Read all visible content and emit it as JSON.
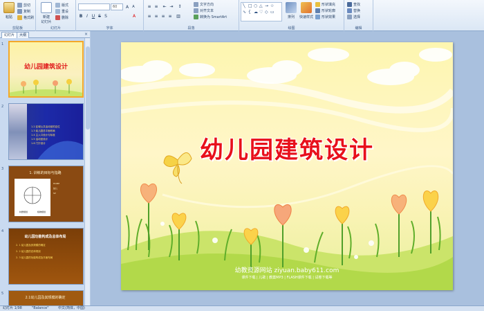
{
  "ribbon": {
    "clipboard": {
      "paste": "粘贴",
      "cut": "剪切",
      "copy": "复制",
      "format_painter": "格式刷",
      "label": "剪贴板"
    },
    "slides": {
      "new_slide": "新建\n幻灯片",
      "layout": "版式",
      "reset": "重设",
      "delete": "删除",
      "label": "幻灯片"
    },
    "font": {
      "size": "60",
      "label": "字体"
    },
    "paragraph": {
      "text_direction": "文字方向",
      "align_text": "对齐文本",
      "smartart": "转换为 SmartArt",
      "label": "段落"
    },
    "drawing": {
      "arrange": "排列",
      "quick_styles": "快速样式",
      "shape_fill": "形状填充",
      "shape_outline": "形状轮廓",
      "shape_effects": "形状效果",
      "label": "绘图"
    },
    "editing": {
      "find": "查找",
      "replace": "替换",
      "select": "选择",
      "label": "编辑"
    }
  },
  "left_panel": {
    "tab_slides": "幻灯片",
    "tab_outline": "大纲",
    "close": "×",
    "slides": [
      {
        "num": "1",
        "title": "幼儿园建筑设计"
      },
      {
        "num": "2",
        "lines": [
          "1.2 区域公共活动室的定位",
          "1.3 幼儿园总平面布局",
          "1.4 主入口设计与标准",
          "1.5 活动室设计",
          "1.6 门厅设计"
        ]
      },
      {
        "num": "3",
        "title": "1. 训练的目标与指路",
        "items": [
          "HOME",
          "幼儿",
          "SP",
          "材质规划",
          "植物规划"
        ]
      },
      {
        "num": "4",
        "title": "幼儿园功能构成及总体布局",
        "items": [
          "2. 1 幼儿园及其规模的确定",
          "2. 2 幼儿园的总体规划",
          "2. 3 幼儿园的功能构成及平面布局"
        ]
      },
      {
        "num": "5",
        "title": "2.1幼儿园及其规模的确定"
      }
    ]
  },
  "slide": {
    "title": "幼儿园建筑设计",
    "footer_site": "幼教资源网站 ziyuan.baby611.com",
    "footer_links": "课件下载 | 儿歌 | 教案MP3 | FLASH课件下载 | 试卷下载等"
  },
  "statusbar": {
    "slide_info": "幻灯片 1/98",
    "theme": "\"Balance\"",
    "language": "中文(简体，中国)"
  }
}
